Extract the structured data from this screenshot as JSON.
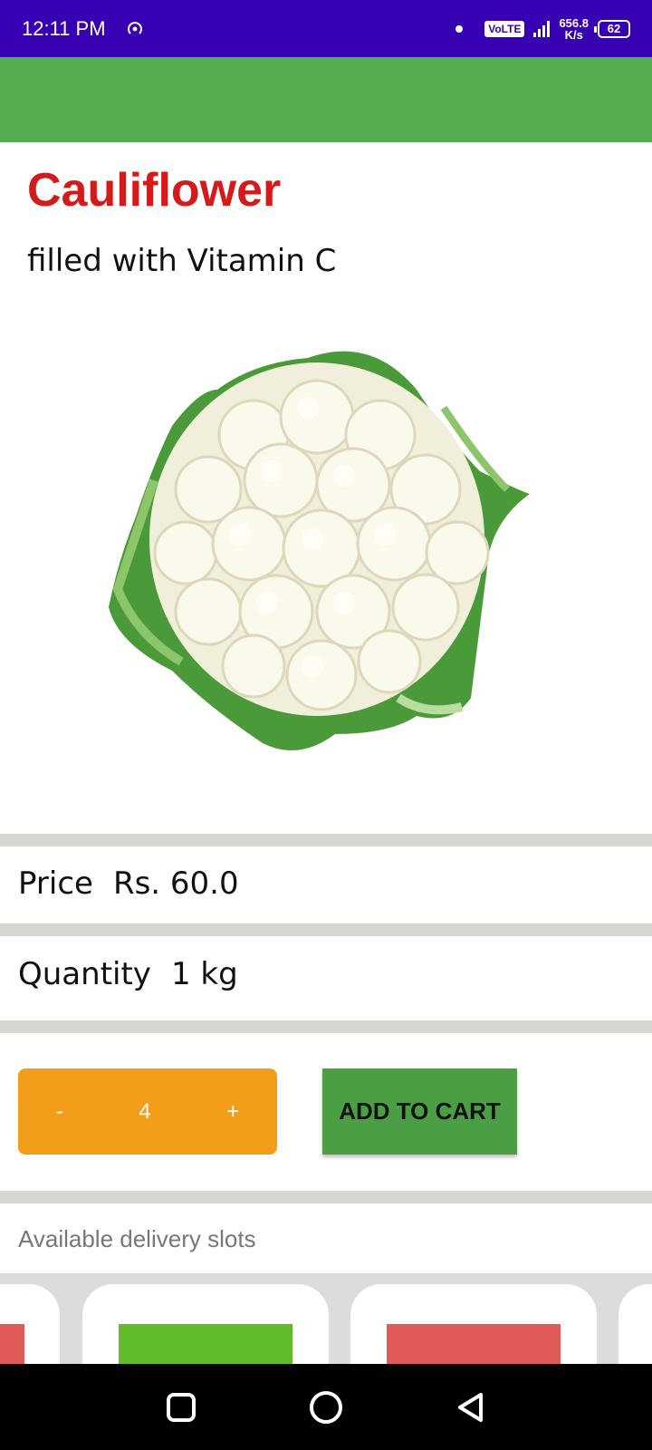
{
  "status_bar": {
    "time": "12:11 PM",
    "volte": "VoLTE",
    "net_speed_value": "656.8",
    "net_speed_unit": "K/s",
    "battery": "62"
  },
  "product": {
    "name": "Cauliflower",
    "description": "filled with Vitamin C",
    "image_icon": "cauliflower-image"
  },
  "price": {
    "label": "Price",
    "value": "Rs. 60.0"
  },
  "quantity": {
    "label": "Quantity",
    "value": "1 kg"
  },
  "stepper": {
    "minus": "-",
    "count": "4",
    "plus": "+"
  },
  "add_to_cart": "ADD TO CART",
  "delivery": {
    "label": "Available delivery slots"
  },
  "colors": {
    "status_bar": "#3700b3",
    "app_bar": "#55ab50",
    "title": "#d41a1a",
    "stepper": "#f29e1a",
    "cart_button": "#4a9f45",
    "slot_green": "#62bb2a",
    "slot_red": "#e05a5a"
  },
  "nav": {
    "icons": [
      "recents-square-icon",
      "home-circle-icon",
      "back-triangle-icon"
    ]
  }
}
